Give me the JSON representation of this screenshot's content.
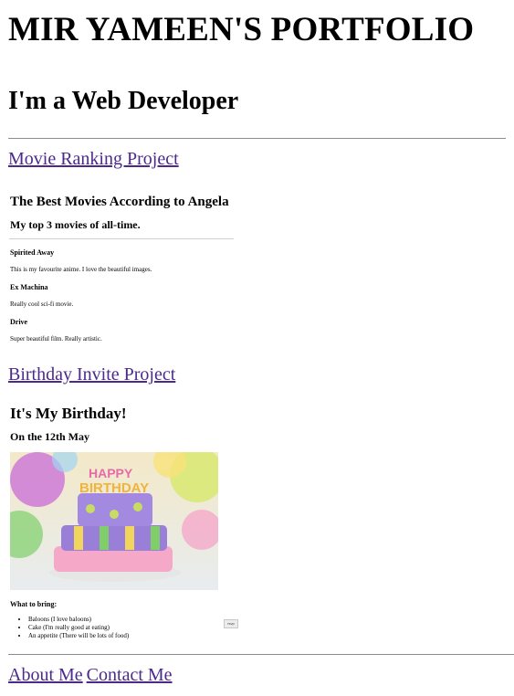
{
  "header": {
    "title": "MIR YAMEEN'S PORTFOLIO",
    "subtitle": "I'm a Web Developer"
  },
  "projects": {
    "movie_link": "Movie Ranking Project",
    "movie": {
      "heading": "The Best Movies According to Angela",
      "subheading": "My top 3 movies of all-time.",
      "movies": [
        {
          "title": "Spirited Away",
          "desc": "This is my favourite anime. I love the beautiful images."
        },
        {
          "title": "Ex Machina",
          "desc": "Really cool sci-fi movie."
        },
        {
          "title": "Drive",
          "desc": "Super beautiful film. Really artistic."
        }
      ]
    },
    "birthday_link": "Birthday Invite Project",
    "birthday": {
      "heading": "It's My Birthday!",
      "date": "On the 12th May",
      "image_alt": "birthday cake",
      "bring_heading": "What to bring:",
      "items": [
        "Baloons (I love baloons)",
        "Cake (I'm really good at eating)",
        "An appetite (There will be lots of food)"
      ],
      "rsvp_button": "rsvp"
    }
  },
  "footer": {
    "about": "About Me",
    "contact": "Contact Me"
  }
}
